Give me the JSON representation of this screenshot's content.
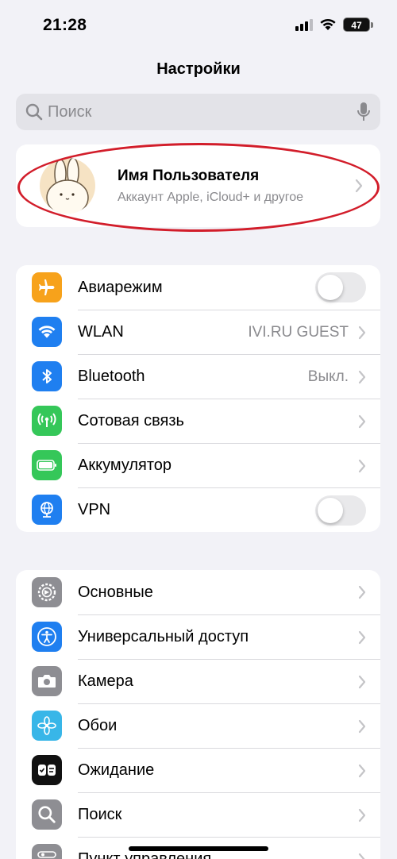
{
  "status": {
    "time": "21:28",
    "battery": "47"
  },
  "header": {
    "title": "Настройки"
  },
  "search": {
    "placeholder": "Поиск"
  },
  "profile": {
    "name": "Имя Пользователя",
    "subtitle": "Аккаунт Apple, iCloud+ и другое"
  },
  "group1": [
    {
      "label": "Авиарежим",
      "icon": "airplane-icon",
      "color": "#f7a21b",
      "type": "toggle",
      "state": "off"
    },
    {
      "label": "WLAN",
      "value": "IVI.RU GUEST",
      "icon": "wifi-icon",
      "color": "#1f7ff0",
      "type": "chevron"
    },
    {
      "label": "Bluetooth",
      "value": "Выкл.",
      "icon": "bluetooth-icon",
      "color": "#1f7ff0",
      "type": "chevron"
    },
    {
      "label": "Сотовая связь",
      "icon": "cellular-icon",
      "color": "#35c759",
      "type": "chevron"
    },
    {
      "label": "Аккумулятор",
      "icon": "battery-icon",
      "color": "#35c759",
      "type": "chevron"
    },
    {
      "label": "VPN",
      "icon": "globe-icon",
      "color": "#1f7ff0",
      "type": "toggle",
      "state": "off"
    }
  ],
  "group2": [
    {
      "label": "Основные",
      "icon": "gear-icon",
      "color": "#8e8e93"
    },
    {
      "label": "Универсальный доступ",
      "icon": "accessibility-icon",
      "color": "#1f7ff0"
    },
    {
      "label": "Камера",
      "icon": "camera-icon",
      "color": "#8e8e93"
    },
    {
      "label": "Обои",
      "icon": "wallpaper-icon",
      "color": "#38b6e8"
    },
    {
      "label": "Ожидание",
      "icon": "standby-icon",
      "color": "#111111"
    },
    {
      "label": "Поиск",
      "icon": "search-icon",
      "color": "#8e8e93"
    },
    {
      "label": "Пункт управления",
      "icon": "control-center-icon",
      "color": "#8e8e93"
    }
  ]
}
